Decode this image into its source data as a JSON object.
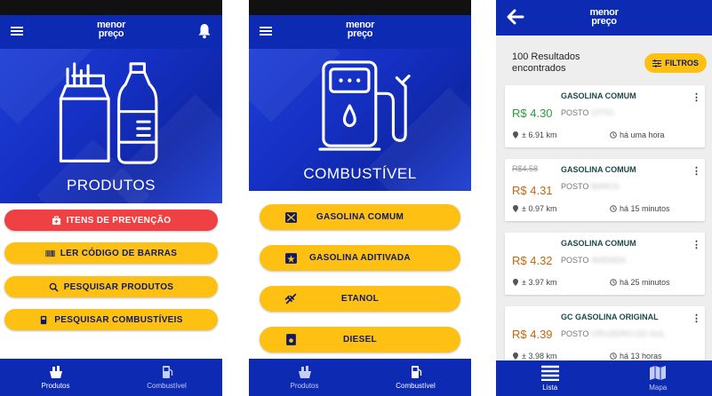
{
  "brand": {
    "line1": "menor",
    "line2": "preço"
  },
  "screen1": {
    "hero_label": "PRODUTOS",
    "buttons": [
      {
        "label": "ITENS DE PREVENÇÃO",
        "icon": "first-aid-icon"
      },
      {
        "label": "LER CÓDIGO DE BARRAS",
        "icon": "barcode-icon"
      },
      {
        "label": "PESQUISAR PRODUTOS",
        "icon": "search-icon"
      },
      {
        "label": "PESQUISAR COMBUSTÍVEIS",
        "icon": "fuel-pump-icon"
      }
    ],
    "nav": [
      {
        "label": "Produtos"
      },
      {
        "label": "Combustível"
      }
    ]
  },
  "screen2": {
    "hero_label": "COMBUSTÍVEL",
    "buttons": [
      {
        "label": "GASOLINA COMUM",
        "icon": "fuel-can-icon"
      },
      {
        "label": "GASOLINA ADITIVADA",
        "icon": "fuel-can-star-icon"
      },
      {
        "label": "ETANOL",
        "icon": "sugarcane-icon"
      },
      {
        "label": "DIESEL",
        "icon": "diesel-drum-icon"
      }
    ],
    "nav": [
      {
        "label": "Produtos"
      },
      {
        "label": "Combustível"
      }
    ]
  },
  "screen3": {
    "results_line1": "100 Resultados",
    "results_line2": "encontrados",
    "filter_label": "FILTROS",
    "posto_label": "POSTO",
    "results": [
      {
        "fuel": "GASOLINA COMUM",
        "old_price": "",
        "price": "R$ 4.30",
        "station": "OTTO",
        "distance": "± 6.91 km",
        "time": "há uma hora",
        "color": "#2e9a3c"
      },
      {
        "fuel": "GASOLINA COMUM",
        "old_price": "R$4.58",
        "price": "R$ 4.31",
        "station": "BARCA",
        "distance": "± 0.97 km",
        "time": "há 15 minutos",
        "color": "#c06810"
      },
      {
        "fuel": "GASOLINA COMUM",
        "old_price": "",
        "price": "R$ 4.32",
        "station": "AVENIDA",
        "distance": "± 3.97 km",
        "time": "há 25 minutos",
        "color": "#c06810"
      },
      {
        "fuel": "GC GASOLINA ORIGINAL",
        "old_price": "",
        "price": "R$ 4.39",
        "station": "CRUZEIRO DO SUL",
        "distance": "± 3.98 km",
        "time": "há 13 horas",
        "color": "#c06810"
      }
    ],
    "nav": [
      {
        "label": "Lista"
      },
      {
        "label": "Mapa"
      }
    ]
  },
  "colors": {
    "primary": "#0d2ab3",
    "accent": "#fdc013",
    "danger": "#ef4043"
  }
}
